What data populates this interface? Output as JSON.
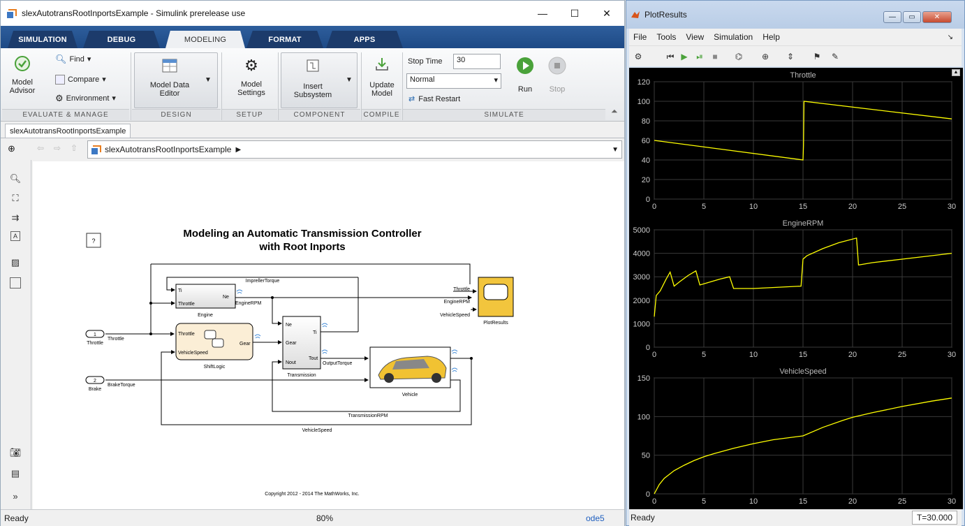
{
  "simulink": {
    "window_title": "slexAutotransRootInportsExample - Simulink prerelease use",
    "tabs": [
      "SIMULATION",
      "DEBUG",
      "MODELING",
      "FORMAT",
      "APPS"
    ],
    "active_tab": "MODELING",
    "ribbon": {
      "model_advisor": "Model\nAdvisor",
      "find": "Find",
      "compare": "Compare",
      "environment": "Environment",
      "model_data_editor": "Model Data\nEditor",
      "model_settings": "Model\nSettings",
      "insert_subsystem": "Insert\nSubsystem",
      "update_model": "Update\nModel",
      "stop_time_label": "Stop Time",
      "stop_time_value": "30",
      "sim_mode": "Normal",
      "fast_restart": "Fast Restart",
      "run": "Run",
      "stop": "Stop",
      "sections": [
        "EVALUATE & MANAGE",
        "DESIGN",
        "SETUP",
        "COMPONENT",
        "COMPILE",
        "SIMULATE"
      ]
    },
    "model_tab": "slexAutotransRootInportsExample",
    "breadcrumb": "slexAutotransRootInportsExample",
    "diagram": {
      "title_line1": "Modeling an Automatic Transmission Controller",
      "title_line2": "with Root Inports",
      "help": "?",
      "blocks": {
        "engine": "Engine",
        "engine_ti": "Ti",
        "engine_throttle": "Throttle",
        "engine_ne": "Ne",
        "shiftlogic": "ShiftLogic",
        "sl_throttle": "Throttle",
        "sl_vehiclespeed": "VehicleSpeed",
        "sl_gear": "Gear",
        "transmission": "Transmission",
        "tr_ne": "Ne",
        "tr_gear": "Gear",
        "tr_nout": "Nout",
        "tr_ti": "Ti",
        "tr_tout": "Tout",
        "vehicle": "Vehicle",
        "plotresults": "PlotResults",
        "in1_num": "1",
        "in1_name": "Throttle",
        "in2_num": "2",
        "in2_name": "Brake"
      },
      "signals": {
        "throttle": "Throttle",
        "brake_torque": "BrakeTorque",
        "impeller_torque": "ImprellerTorque",
        "engine_rpm": "EngineRPM",
        "output_torque": "OutputTorque",
        "transmission_rpm": "TransmissionRPM",
        "vehicle_speed": "VehicleSpeed",
        "scope_throttle": "Throttle",
        "scope_enginerpm": "EngineRPM",
        "scope_vehiclespeed": "VehicleSpeed"
      },
      "copyright": "Copyright 2012 - 2014 The MathWorks, Inc."
    },
    "status": {
      "left": "Ready",
      "zoom": "80%",
      "solver": "ode5"
    }
  },
  "plot": {
    "window_title": "PlotResults",
    "menu": [
      "File",
      "Tools",
      "View",
      "Simulation",
      "Help"
    ],
    "status": {
      "left": "Ready",
      "time": "T=30.000"
    }
  },
  "chart_data": [
    {
      "type": "line",
      "title": "Throttle",
      "xlim": [
        0,
        30
      ],
      "ylim": [
        0,
        120
      ],
      "xticks": [
        0,
        5,
        10,
        15,
        20,
        25,
        30
      ],
      "yticks": [
        0,
        20,
        40,
        60,
        80,
        100,
        120
      ],
      "series": [
        {
          "x": [
            0,
            15,
            15.05,
            15.1,
            30
          ],
          "y": [
            60,
            40,
            55,
            100,
            82
          ],
          "color": "#ffff00"
        }
      ],
      "grid": true
    },
    {
      "type": "line",
      "title": "EngineRPM",
      "xlim": [
        0,
        30
      ],
      "ylim": [
        0,
        5000
      ],
      "xticks": [
        0,
        5,
        10,
        15,
        20,
        25,
        30
      ],
      "yticks": [
        0,
        1000,
        2000,
        3000,
        4000,
        5000
      ],
      "series": [
        {
          "x": [
            0,
            0.2,
            0.6,
            1.2,
            1.6,
            2.0,
            2.6,
            3.4,
            4.2,
            4.6,
            5.4,
            6.6,
            7.6,
            8.0,
            10.0,
            14.8,
            15.0,
            15.4,
            17.0,
            18.6,
            20.4,
            20.6,
            22.0,
            25.0,
            28.0,
            30.0
          ],
          "y": [
            1300,
            2200,
            2400,
            2900,
            3200,
            2600,
            2800,
            3050,
            3250,
            2650,
            2750,
            2900,
            3000,
            2500,
            2500,
            2600,
            3750,
            3900,
            4200,
            4450,
            4650,
            3500,
            3600,
            3750,
            3900,
            4000
          ],
          "color": "#ffff00"
        }
      ],
      "grid": true
    },
    {
      "type": "line",
      "title": "VehicleSpeed",
      "xlim": [
        0,
        30
      ],
      "ylim": [
        0,
        150
      ],
      "xticks": [
        0,
        5,
        10,
        15,
        20,
        25,
        30
      ],
      "yticks": [
        0,
        50,
        100,
        150
      ],
      "series": [
        {
          "x": [
            0,
            0.5,
            1,
            2,
            3,
            4,
            5,
            6,
            8,
            10,
            12,
            15,
            17,
            19,
            20,
            22,
            25,
            28,
            30
          ],
          "y": [
            0,
            12,
            20,
            30,
            37,
            43,
            48,
            52,
            59,
            65,
            70,
            75,
            86,
            95,
            99,
            105,
            113,
            120,
            124
          ],
          "color": "#ffff00"
        }
      ],
      "grid": true
    }
  ]
}
